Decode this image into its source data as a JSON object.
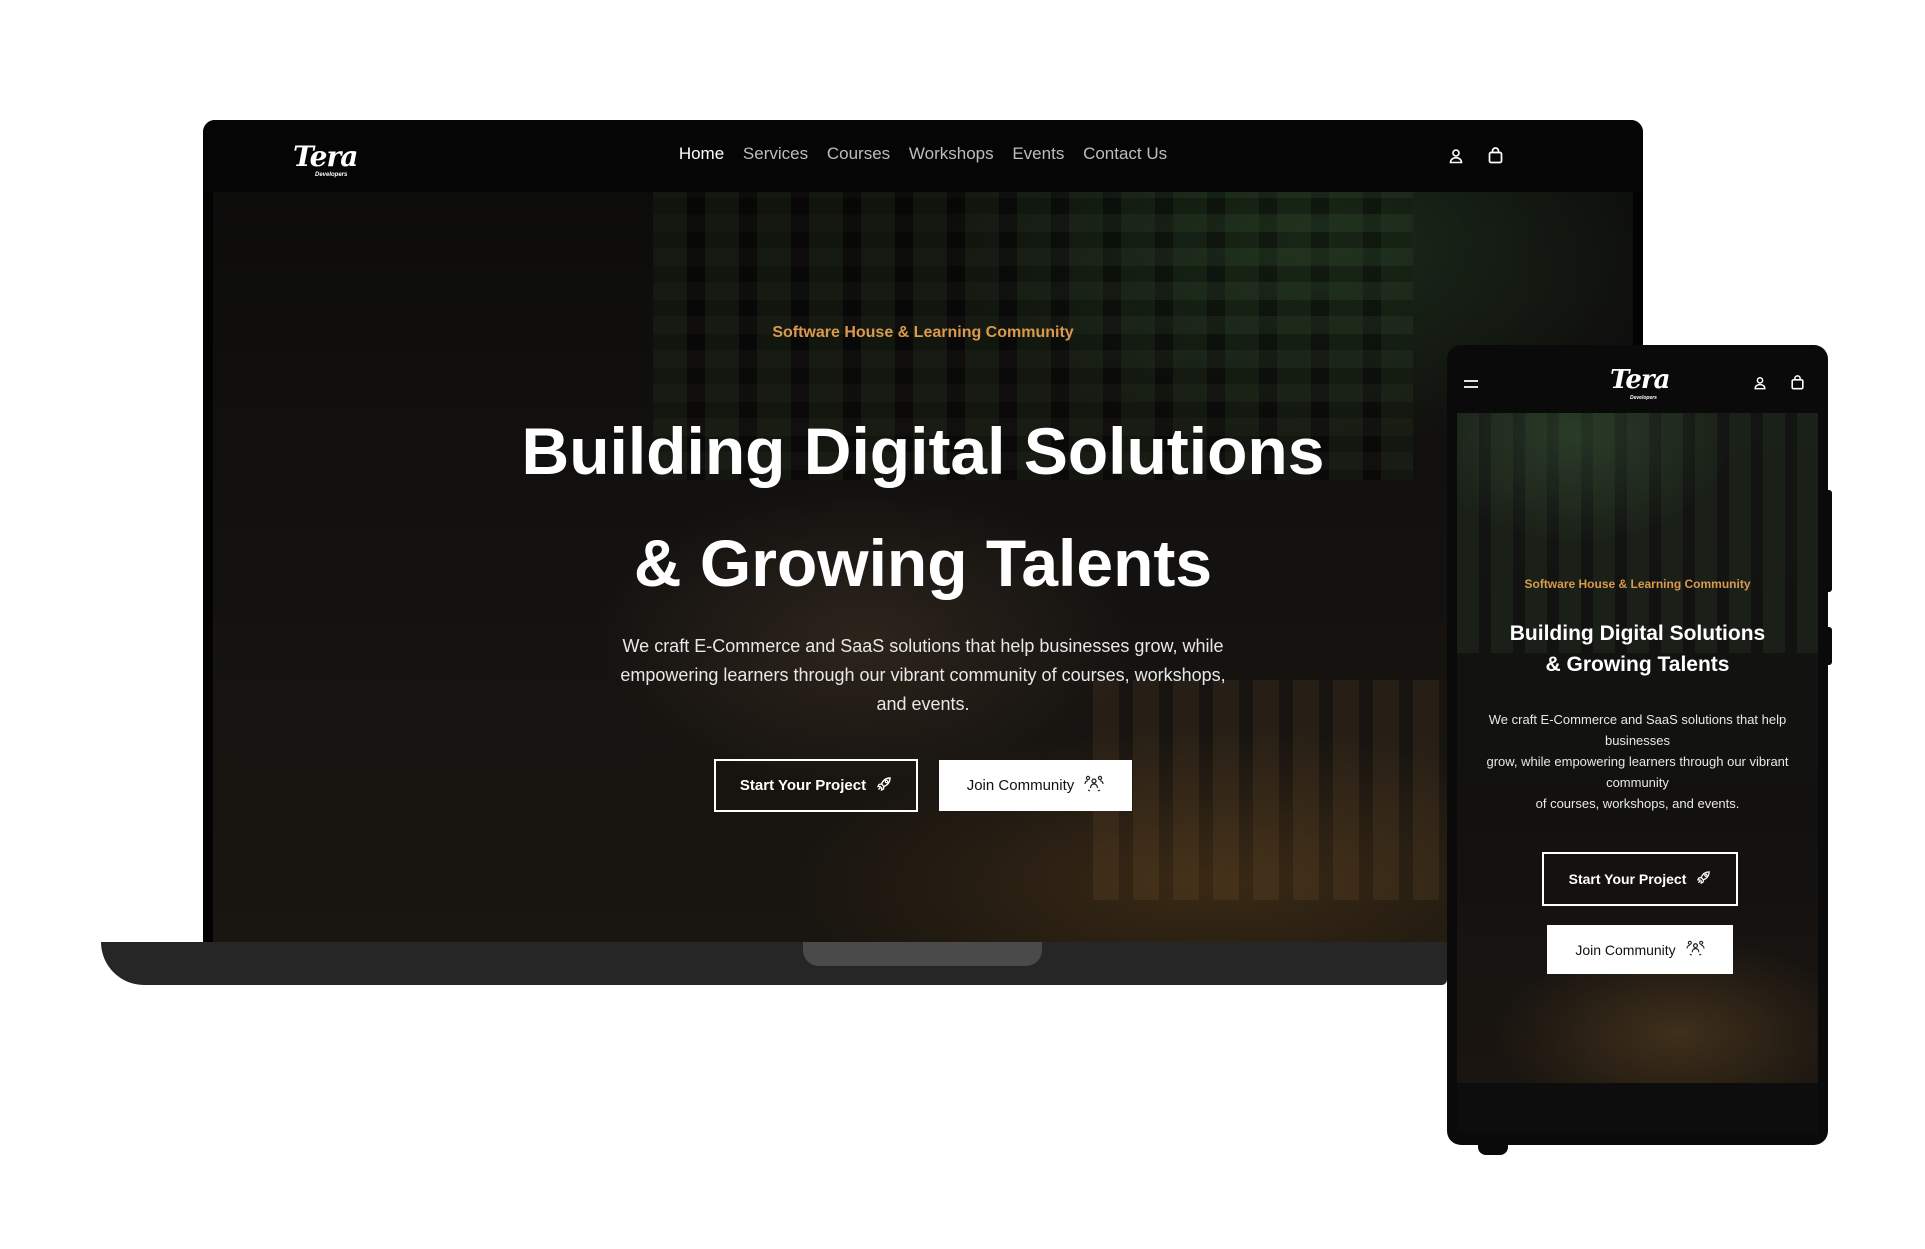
{
  "brand": {
    "logo_text": "Tera",
    "logo_subtext": "Developers"
  },
  "nav": {
    "items": [
      {
        "label": "Home",
        "active": true
      },
      {
        "label": "Services",
        "active": false
      },
      {
        "label": "Courses",
        "active": false
      },
      {
        "label": "Workshops",
        "active": false
      },
      {
        "label": "Events",
        "active": false
      },
      {
        "label": "Contact Us",
        "active": false
      }
    ],
    "account_icon": "user-icon",
    "cart_icon": "shopping-bag-icon",
    "menu_icon": "hamburger-menu-icon"
  },
  "hero": {
    "tagline": "Software House & Learning Community",
    "headline_line1": "Building Digital Solutions",
    "headline_line2": "& Growing Talents",
    "description": "We craft E-Commerce and SaaS solutions that help businesses grow, while empowering learners through our vibrant community of courses, workshops, and events.",
    "mobile_description_lines": [
      "We craft E-Commerce and SaaS solutions that help businesses",
      "grow, while empowering learners through our vibrant community",
      "of courses, workshops, and events."
    ],
    "primary_button": {
      "label": "Start Your Project",
      "icon": "rocket-icon"
    },
    "secondary_button": {
      "label": "Join Community",
      "icon": "community-icon"
    }
  },
  "colors": {
    "accent": "#d99a4e",
    "background": "#0b0b0a",
    "text": "#ffffff",
    "nav_inactive": "#bdbdbd"
  }
}
